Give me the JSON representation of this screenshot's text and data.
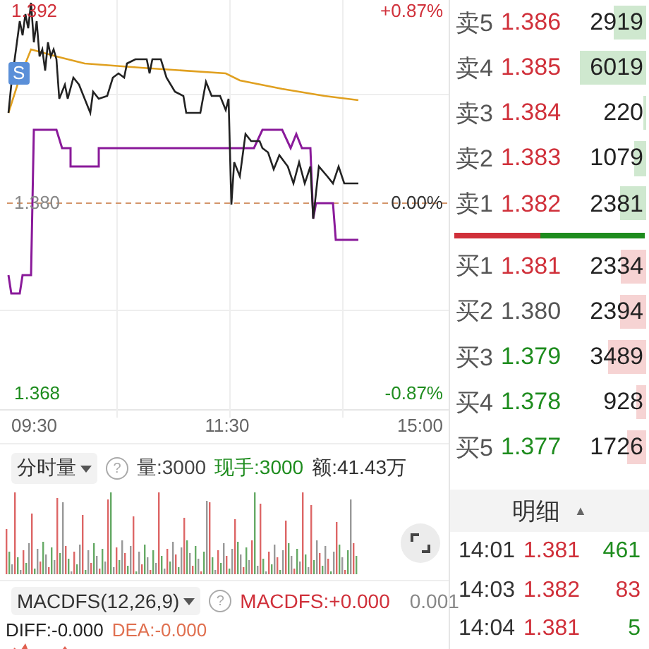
{
  "price_chart": {
    "high_price": "1.392",
    "high_pct": "+0.87%",
    "base_price": "1.380",
    "base_pct": "0.00%",
    "low_price": "1.368",
    "low_pct": "-0.87%",
    "marker": "S"
  },
  "time_axis": [
    "09:30",
    "11:30",
    "15:00"
  ],
  "volume_panel": {
    "indicator": "分时量",
    "help": "?",
    "volume": "量:3000",
    "current_hand": "现手:3000",
    "amount": "额:41.43万"
  },
  "macd_panel": {
    "indicator": "MACDFS(12,26,9)",
    "help": "?",
    "macdfs": "MACDFS:+0.000",
    "scale": "0.001",
    "diff": "DIFF:-0.000",
    "dea": "DEA:-0.000"
  },
  "order_book": [
    {
      "label": "卖5",
      "price": "1.386",
      "volume": "2919",
      "kind": "sell",
      "color": "#d0303a"
    },
    {
      "label": "卖4",
      "price": "1.385",
      "volume": "6019",
      "kind": "sell",
      "color": "#d0303a"
    },
    {
      "label": "卖3",
      "price": "1.384",
      "volume": "220",
      "kind": "sell",
      "color": "#d0303a"
    },
    {
      "label": "卖2",
      "price": "1.383",
      "volume": "1079",
      "kind": "sell",
      "color": "#d0303a"
    },
    {
      "label": "卖1",
      "price": "1.382",
      "volume": "2381",
      "kind": "sell",
      "color": "#d0303a"
    },
    {
      "label": "买1",
      "price": "1.381",
      "volume": "2334",
      "kind": "buy",
      "color": "#d0303a"
    },
    {
      "label": "买2",
      "price": "1.380",
      "volume": "2394",
      "kind": "buy",
      "color": "#555555"
    },
    {
      "label": "买3",
      "price": "1.379",
      "volume": "3489",
      "kind": "buy",
      "color": "#1e8c1e"
    },
    {
      "label": "买4",
      "price": "1.378",
      "volume": "928",
      "kind": "buy",
      "color": "#1e8c1e"
    },
    {
      "label": "买5",
      "price": "1.377",
      "volume": "1726",
      "kind": "buy",
      "color": "#1e8c1e"
    }
  ],
  "ratio_bar": {
    "level": 0.45
  },
  "details": {
    "title": "明细",
    "sort": "▲",
    "rows": [
      {
        "time": "14:01",
        "price": "1.381",
        "volume": "461",
        "color": "#1e8c1e"
      },
      {
        "time": "14:03",
        "price": "1.382",
        "volume": "83",
        "color": "#d0303a"
      },
      {
        "time": "14:04",
        "price": "1.381",
        "volume": "5",
        "color": "#1e8c1e"
      }
    ]
  }
}
